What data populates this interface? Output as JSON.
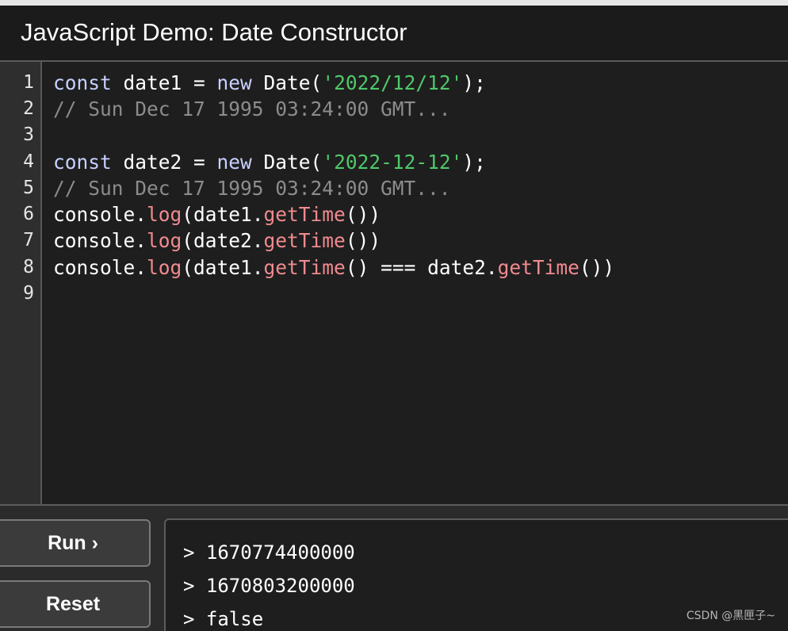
{
  "window": {
    "title": "JavaScript Demo: Date Constructor"
  },
  "editor": {
    "line_numbers": [
      "1",
      "2",
      "3",
      "4",
      "5",
      "6",
      "7",
      "8",
      "9"
    ],
    "lines": [
      [
        {
          "t": "kw",
          "v": "const"
        },
        {
          "t": "id",
          "v": " date1 = "
        },
        {
          "t": "kw",
          "v": "new"
        },
        {
          "t": "id",
          "v": " Date("
        },
        {
          "t": "str",
          "v": "'2022/12/12'"
        },
        {
          "t": "id",
          "v": ");"
        }
      ],
      [
        {
          "t": "cm",
          "v": "// Sun Dec 17 1995 03:24:00 GMT..."
        }
      ],
      [],
      [
        {
          "t": "kw",
          "v": "const"
        },
        {
          "t": "id",
          "v": " date2 = "
        },
        {
          "t": "kw",
          "v": "new"
        },
        {
          "t": "id",
          "v": " Date("
        },
        {
          "t": "str",
          "v": "'2022-12-12'"
        },
        {
          "t": "id",
          "v": ");"
        }
      ],
      [
        {
          "t": "cm",
          "v": "// Sun Dec 17 1995 03:24:00 GMT..."
        }
      ],
      [
        {
          "t": "id",
          "v": "console."
        },
        {
          "t": "fn",
          "v": "log"
        },
        {
          "t": "id",
          "v": "(date1."
        },
        {
          "t": "fn",
          "v": "getTime"
        },
        {
          "t": "id",
          "v": "())"
        }
      ],
      [
        {
          "t": "id",
          "v": "console."
        },
        {
          "t": "fn",
          "v": "log"
        },
        {
          "t": "id",
          "v": "(date2."
        },
        {
          "t": "fn",
          "v": "getTime"
        },
        {
          "t": "id",
          "v": "())"
        }
      ],
      [
        {
          "t": "id",
          "v": "console."
        },
        {
          "t": "fn",
          "v": "log"
        },
        {
          "t": "id",
          "v": "(date1."
        },
        {
          "t": "fn",
          "v": "getTime"
        },
        {
          "t": "id",
          "v": "() === date2."
        },
        {
          "t": "fn",
          "v": "getTime"
        },
        {
          "t": "id",
          "v": "())"
        }
      ],
      []
    ]
  },
  "buttons": {
    "run_label": "Run ›",
    "reset_label": "Reset"
  },
  "output": {
    "lines": [
      "> 1670774400000",
      "> 1670803200000",
      "> false"
    ]
  },
  "watermark": "CSDN @黑匣子~",
  "colors": {
    "keyword": "#c8d0ff",
    "string": "#4fc86a",
    "comment": "#8c8c8c",
    "function": "#f08a8f",
    "editor_bg": "#1e1e1e",
    "gutter_bg": "#2e2e2e"
  }
}
